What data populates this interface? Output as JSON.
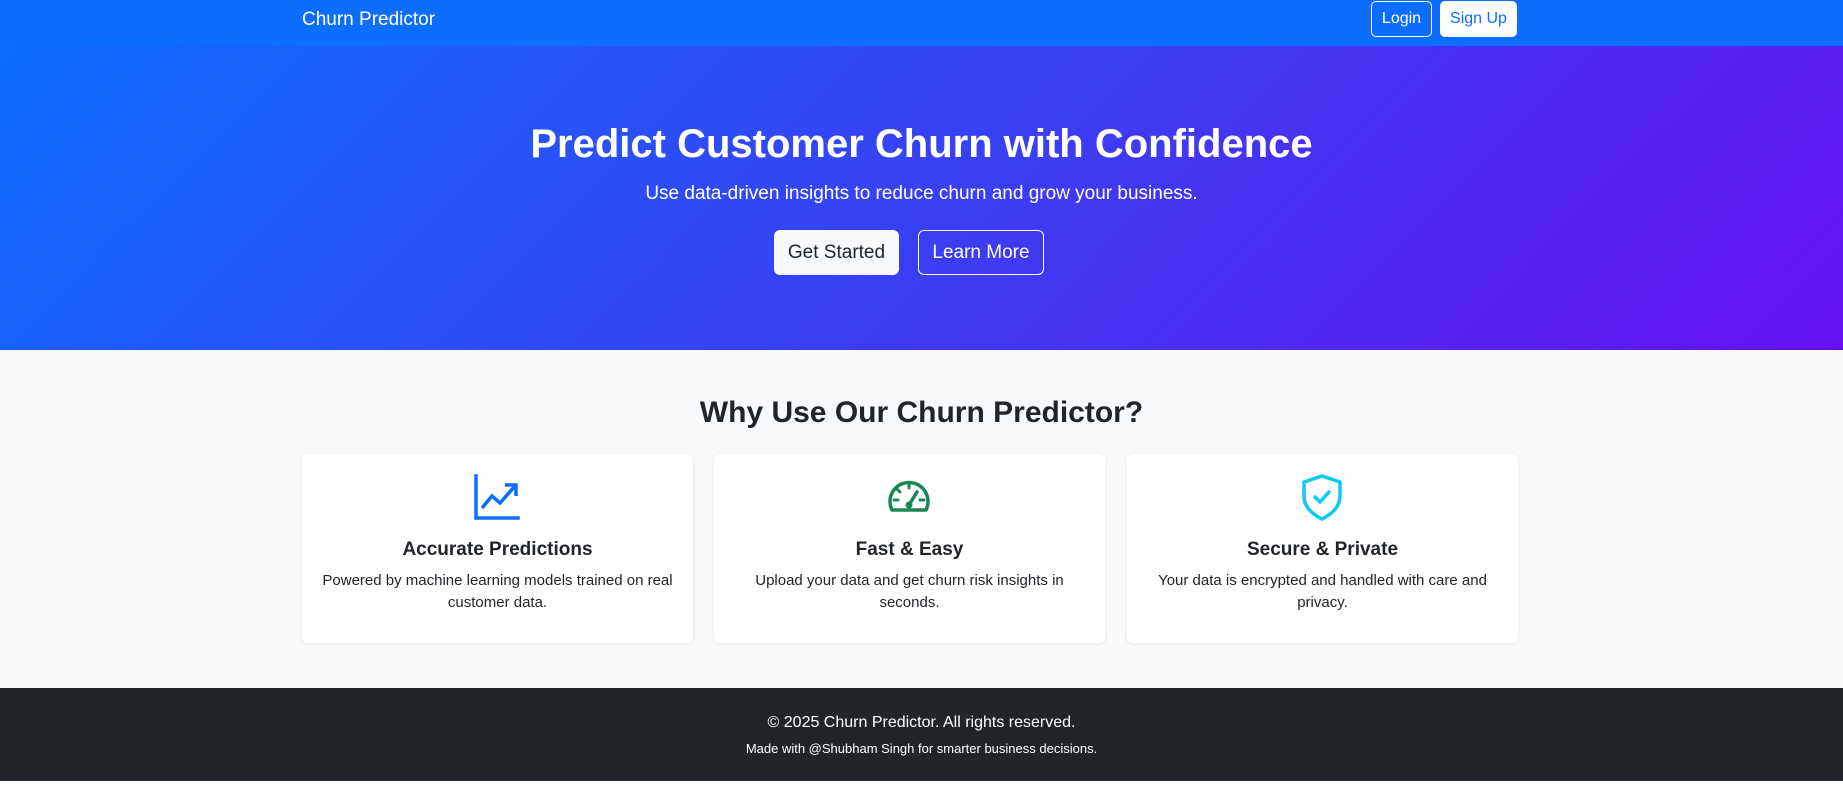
{
  "navbar": {
    "brand": "Churn Predictor",
    "login_label": "Login",
    "signup_label": "Sign Up"
  },
  "hero": {
    "title": "Predict Customer Churn with Confidence",
    "subtitle": "Use data-driven insights to reduce churn and grow your business.",
    "get_started_label": "Get Started",
    "learn_more_label": "Learn More"
  },
  "features": {
    "title": "Why Use Our Churn Predictor?",
    "cards": [
      {
        "icon": "graph-up-icon",
        "icon_color": "#0d6efd",
        "title": "Accurate Predictions",
        "text": "Powered by machine learning models trained on real customer data."
      },
      {
        "icon": "speedometer-icon",
        "icon_color": "#198754",
        "title": "Fast & Easy",
        "text": "Upload your data and get churn risk insights in seconds."
      },
      {
        "icon": "shield-check-icon",
        "icon_color": "#0dcaf0",
        "title": "Secure & Private",
        "text": "Your data is encrypted and handled with care and privacy."
      }
    ]
  },
  "footer": {
    "copyright": "© 2025 Churn Predictor. All rights reserved.",
    "made_with": "Made with @Shubham Singh for smarter business decisions."
  },
  "colors": {
    "primary": "#0d6efd",
    "gradient_end": "#6610f2",
    "footer_bg": "#212529",
    "section_bg": "#f8f9fa"
  }
}
